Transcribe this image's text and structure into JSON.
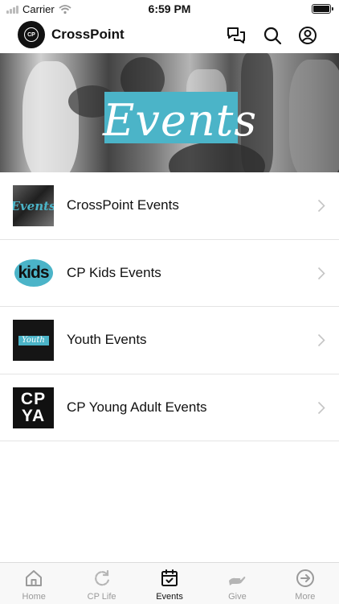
{
  "status_bar": {
    "carrier": "Carrier",
    "time": "6:59 PM"
  },
  "header": {
    "title": "CrossPoint",
    "logo_text": "CP"
  },
  "hero": {
    "title": "Events"
  },
  "events": [
    {
      "label": "CrossPoint Events",
      "thumb_text": "Events"
    },
    {
      "label": "CP Kids Events",
      "thumb_text": "kids"
    },
    {
      "label": "Youth Events",
      "thumb_text": "Youth"
    },
    {
      "label": "CP Young Adult Events",
      "thumb_text_line1": "CP",
      "thumb_text_line2": "YA"
    }
  ],
  "tabs": [
    {
      "label": "Home",
      "icon": "home-icon"
    },
    {
      "label": "CP Life",
      "icon": "refresh-icon"
    },
    {
      "label": "Events",
      "icon": "calendar-check-icon"
    },
    {
      "label": "Give",
      "icon": "hand-icon"
    },
    {
      "label": "More",
      "icon": "arrow-circle-right-icon"
    }
  ],
  "colors": {
    "accent": "#4bb4c8",
    "tab_active": "#111111",
    "tab_inactive": "#9a9a9a"
  }
}
